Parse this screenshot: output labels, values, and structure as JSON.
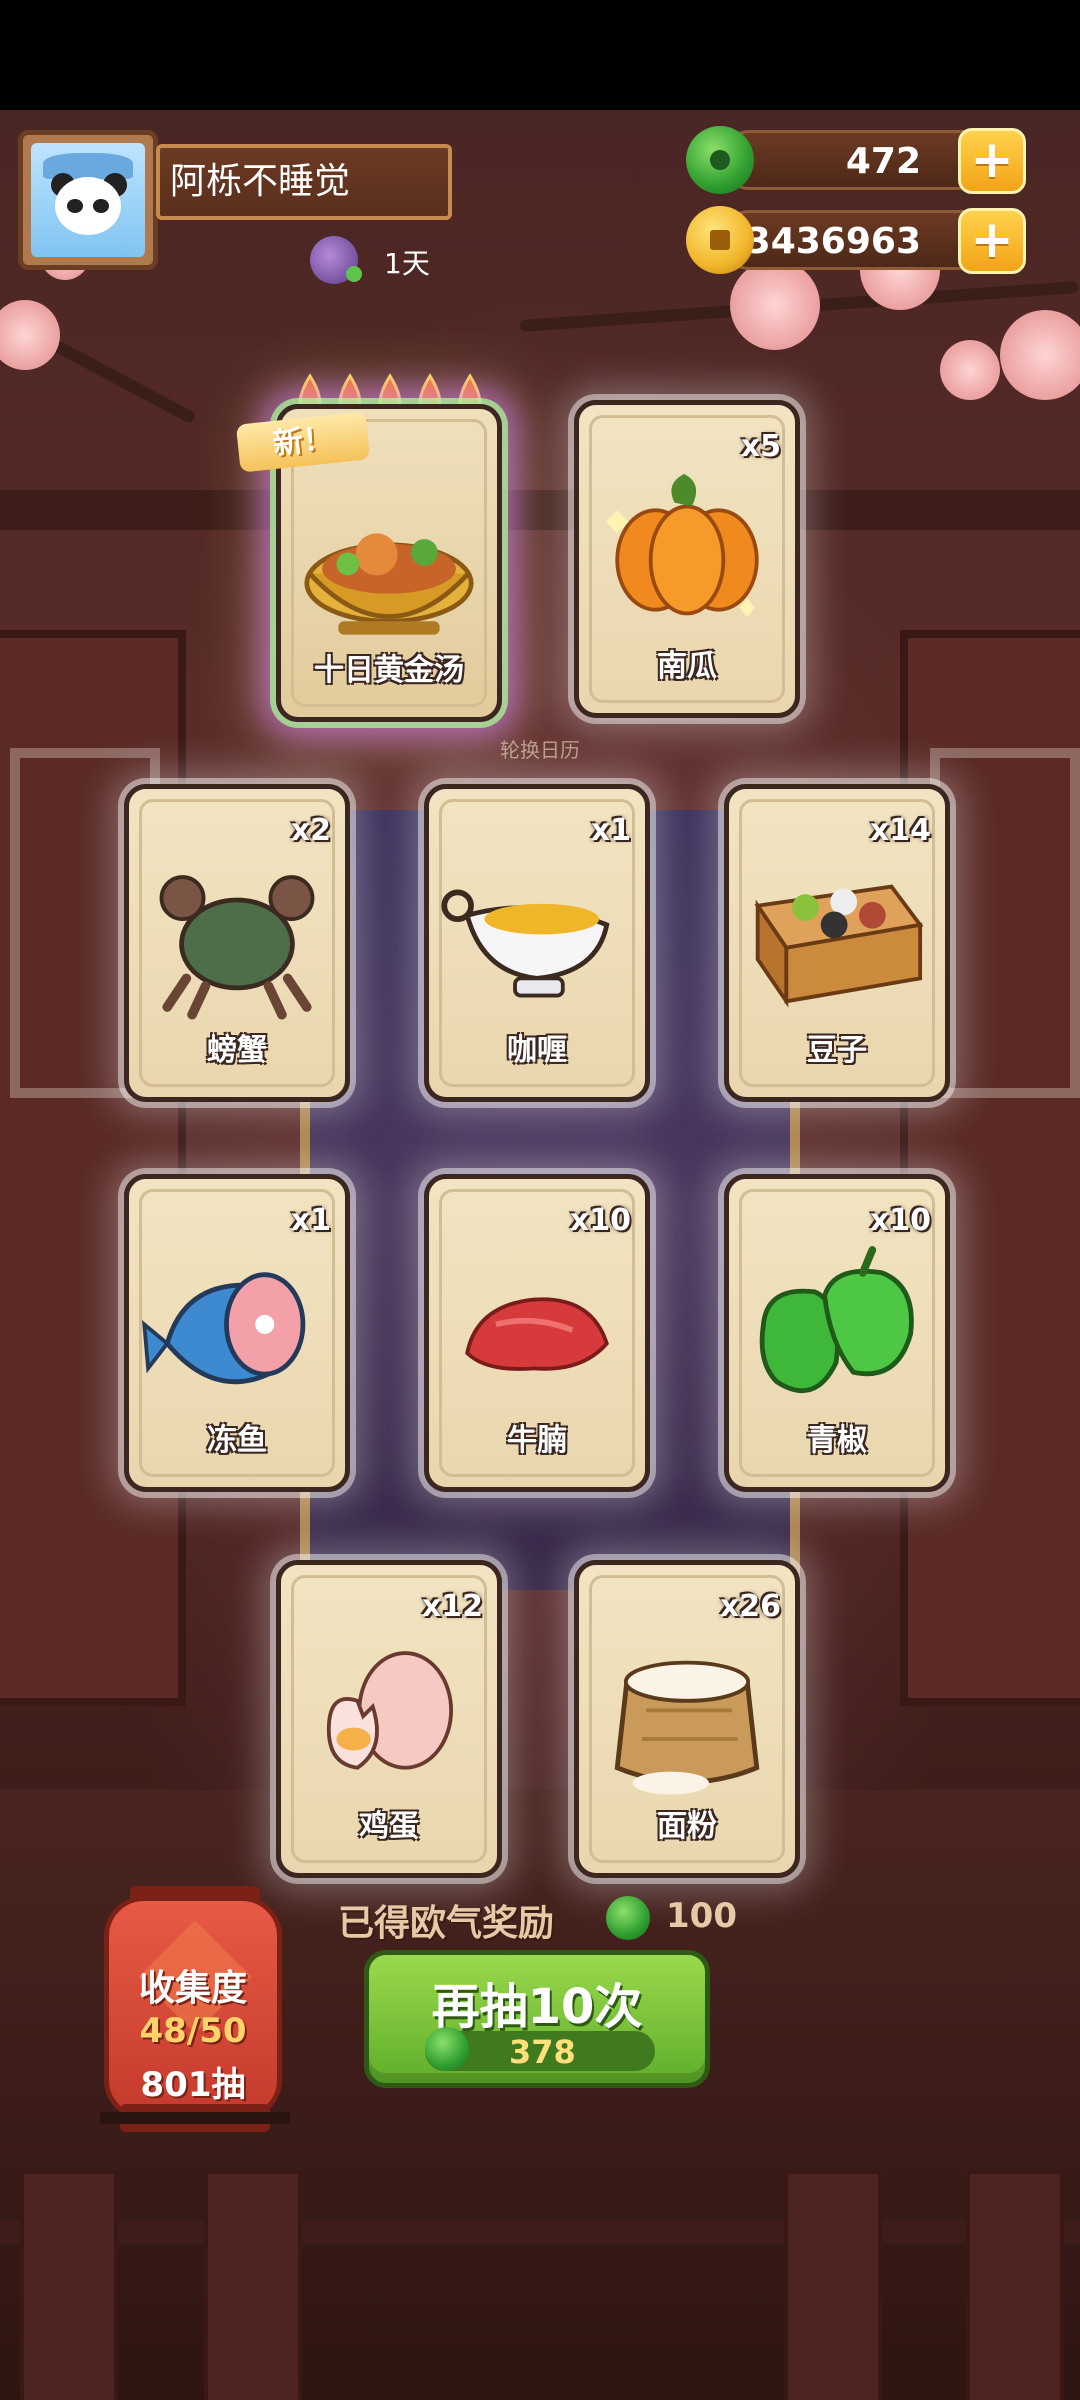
{
  "player": {
    "name": "阿栎不睡觉",
    "days": "1天"
  },
  "currency": {
    "jade": "472",
    "coins": "3436963"
  },
  "banner_label": "轮换日历",
  "featured": {
    "badge": "新！",
    "name": "十日黄金汤"
  },
  "cards": [
    {
      "name": "南瓜",
      "count": "x5",
      "icon": "pumpkin-icon"
    },
    {
      "name": "螃蟹",
      "count": "x2",
      "icon": "crab-icon"
    },
    {
      "name": "咖喱",
      "count": "x1",
      "icon": "curry-icon"
    },
    {
      "name": "豆子",
      "count": "x14",
      "icon": "beans-icon"
    },
    {
      "name": "冻鱼",
      "count": "x1",
      "icon": "frozen-fish-icon"
    },
    {
      "name": "牛腩",
      "count": "x10",
      "icon": "beef-icon"
    },
    {
      "name": "青椒",
      "count": "x10",
      "icon": "green-pepper-icon"
    },
    {
      "name": "鸡蛋",
      "count": "x12",
      "icon": "egg-icon"
    },
    {
      "name": "面粉",
      "count": "x26",
      "icon": "flour-icon"
    }
  ],
  "lucky_reward": {
    "label": "已得欧气奖励",
    "value": "100"
  },
  "draw_button": {
    "label": "再抽10次",
    "cost": "378"
  },
  "collection": {
    "label": "收集度",
    "progress": "48/50",
    "draws": "801抽"
  },
  "colors": {
    "accent_green": "#5fae2a",
    "gold": "#f2a417",
    "lantern_red": "#c43a2c"
  }
}
